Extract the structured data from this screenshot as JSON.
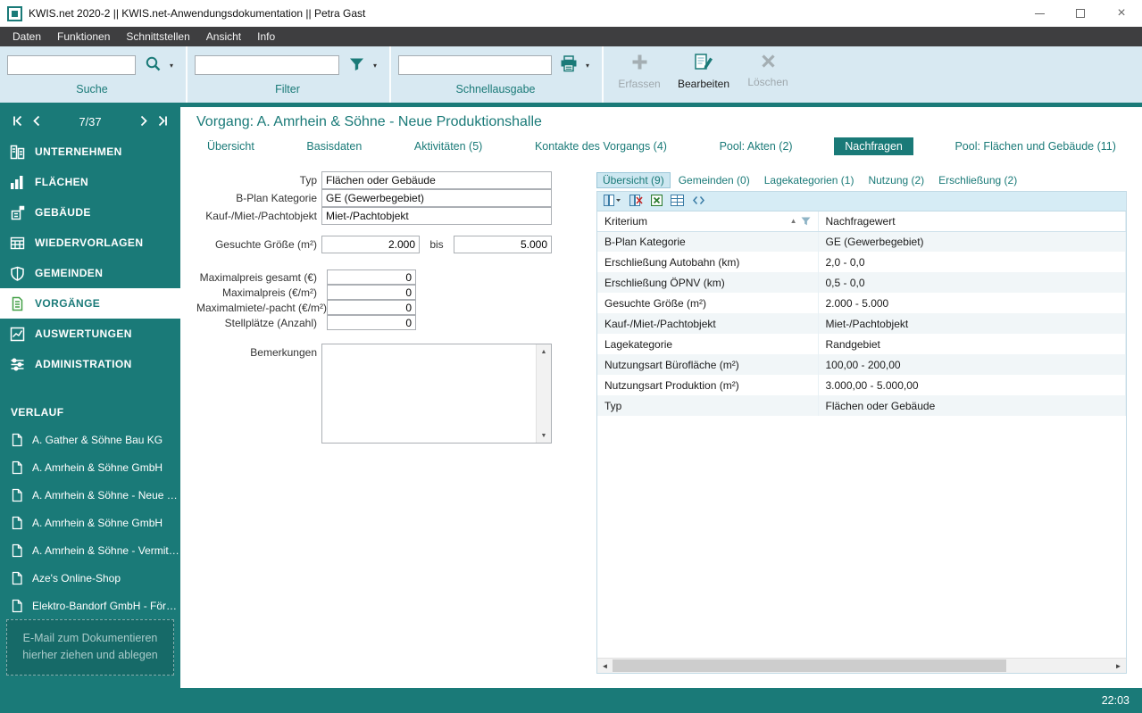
{
  "window": {
    "title": "KWIS.net 2020-2 || KWIS.net-Anwendungsdokumentation || Petra Gast"
  },
  "menubar": {
    "items": [
      "Daten",
      "Funktionen",
      "Schnittstellen",
      "Ansicht",
      "Info"
    ]
  },
  "toolbar": {
    "search": {
      "label": "Suche",
      "value": "",
      "icon": "magnifier-icon"
    },
    "filter": {
      "label": "Filter",
      "value": "",
      "icon": "funnel-icon"
    },
    "quick_output": {
      "label": "Schnellausgabe",
      "value": "",
      "icon": "printer-icon"
    },
    "actions": [
      {
        "label": "Erfassen",
        "icon": "plus-icon",
        "enabled": false
      },
      {
        "label": "Bearbeiten",
        "icon": "edit-icon",
        "enabled": true
      },
      {
        "label": "Löschen",
        "icon": "delete-icon",
        "enabled": false
      }
    ]
  },
  "sidebar": {
    "pager": "7/37",
    "nav": [
      {
        "label": "UNTERNEHMEN",
        "icon": "company-icon",
        "selected": false
      },
      {
        "label": "FLÄCHEN",
        "icon": "areas-icon",
        "selected": false
      },
      {
        "label": "GEBÄUDE",
        "icon": "buildings-icon",
        "selected": false
      },
      {
        "label": "WIEDERVORLAGEN",
        "icon": "reminders-icon",
        "selected": false
      },
      {
        "label": "GEMEINDEN",
        "icon": "municipalities-icon",
        "selected": false
      },
      {
        "label": "VORGÄNGE",
        "icon": "processes-icon",
        "selected": true
      },
      {
        "label": "AUSWERTUNGEN",
        "icon": "reports-icon",
        "selected": false
      },
      {
        "label": "ADMINISTRATION",
        "icon": "administration-icon",
        "selected": false
      }
    ],
    "history_header": "VERLAUF",
    "history": [
      "A. Gather & Söhne Bau KG",
      "A. Amrhein & Söhne GmbH",
      "A. Amrhein & Söhne - Neue Pr...",
      "A. Amrhein & Söhne GmbH",
      "A. Amrhein & Söhne - Vermittl...",
      "Aze's Online-Shop",
      "Elektro-Bandorf GmbH - Förde..."
    ],
    "dropzone": {
      "line1": "E-Mail zum Dokumentieren",
      "line2": "hierher ziehen und ablegen"
    }
  },
  "main": {
    "title": "Vorgang: A. Amrhein & Söhne - Neue Produktionshalle",
    "tabs": [
      {
        "label": "Übersicht",
        "selected": false
      },
      {
        "label": "Basisdaten",
        "selected": false
      },
      {
        "label": "Aktivitäten (5)",
        "selected": false
      },
      {
        "label": "Kontakte des Vorgangs (4)",
        "selected": false
      },
      {
        "label": "Pool: Akten (2)",
        "selected": false
      },
      {
        "label": "Nachfragen",
        "selected": true
      },
      {
        "label": "Pool: Flächen und Gebäude (11)",
        "selected": false
      }
    ],
    "form": {
      "typ_label": "Typ",
      "typ_value": "Flächen oder Gebäude",
      "bplan_label": "B-Plan Kategorie",
      "bplan_value": "GE (Gewerbegebiet)",
      "objekt_label": "Kauf-/Miet-/Pachtobjekt",
      "objekt_value": "Miet-/Pachtobjekt",
      "groesse_label": "Gesuchte Größe (m²)",
      "groesse_von": "2.000",
      "bis_label": "bis",
      "groesse_bis": "5.000",
      "maxpreis_gesamt_label": "Maximalpreis gesamt (€)",
      "maxpreis_gesamt_value": "0",
      "maxpreis_label": "Maximalpreis (€/m²)",
      "maxpreis_value": "0",
      "maxmiete_label": "Maximalmiete/-pacht (€/m²)",
      "maxmiete_value": "0",
      "stellplaetze_label": "Stellplätze (Anzahl)",
      "stellplaetze_value": "0",
      "bemerkungen_label": "Bemerkungen",
      "bemerkungen_value": ""
    },
    "panel": {
      "tabs": [
        {
          "label": "Übersicht (9)",
          "selected": true
        },
        {
          "label": "Gemeinden (0)",
          "selected": false
        },
        {
          "label": "Lagekategorien (1)",
          "selected": false
        },
        {
          "label": "Nutzung (2)",
          "selected": false
        },
        {
          "label": "Erschließung (2)",
          "selected": false
        }
      ],
      "toolbar_icons": [
        "columns-icon",
        "hide-column-icon",
        "excel-export-icon",
        "grid-icon",
        "fit-columns-icon"
      ],
      "table": {
        "columns": [
          "Kriterium",
          "Nachfragewert"
        ],
        "rows": [
          [
            "B-Plan Kategorie",
            "GE (Gewerbegebiet)"
          ],
          [
            "Erschließung Autobahn (km)",
            "2,0 - 0,0"
          ],
          [
            "Erschließung ÖPNV (km)",
            "0,5 - 0,0"
          ],
          [
            "Gesuchte Größe (m²)",
            "2.000 - 5.000"
          ],
          [
            "Kauf-/Miet-/Pachtobjekt",
            "Miet-/Pachtobjekt"
          ],
          [
            "Lagekategorie",
            "Randgebiet"
          ],
          [
            "Nutzungsart Bürofläche (m²)",
            "100,00 - 200,00"
          ],
          [
            "Nutzungsart Produktion (m²)",
            "3.000,00 - 5.000,00"
          ],
          [
            "Typ",
            "Flächen oder Gebäude"
          ]
        ]
      }
    }
  },
  "statusbar": {
    "time": "22:03"
  }
}
